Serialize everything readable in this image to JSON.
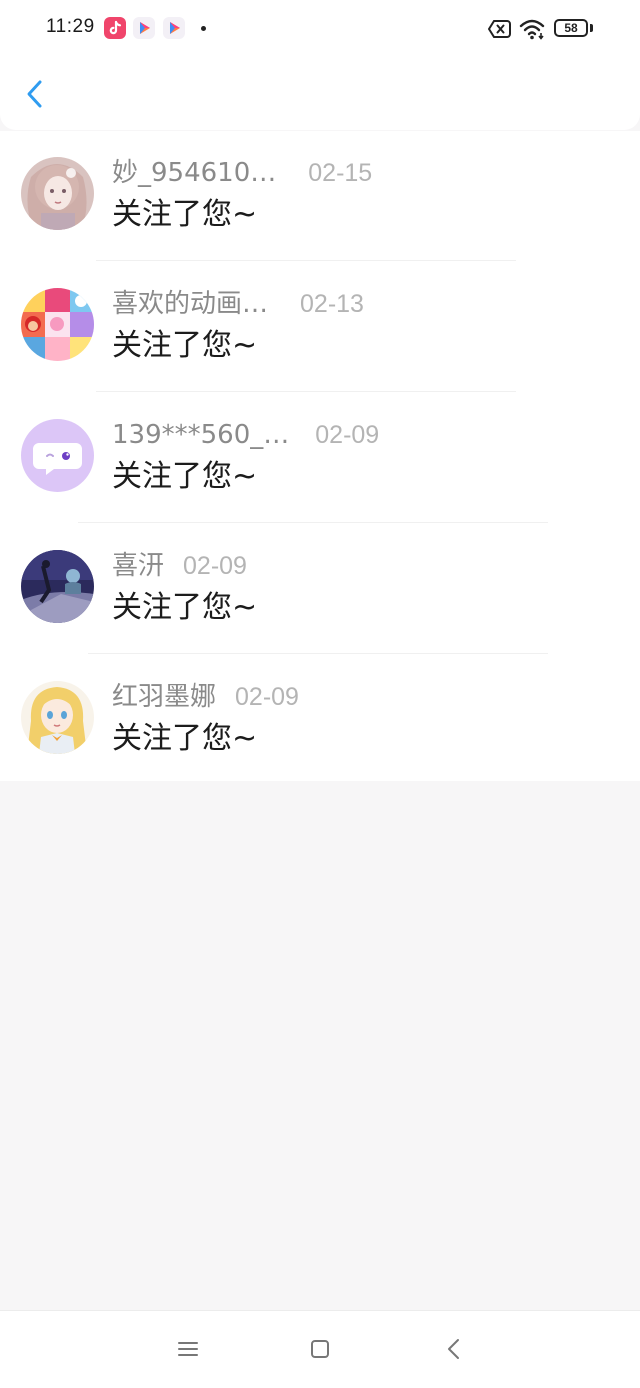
{
  "status_bar": {
    "time": "11:29",
    "battery": "58",
    "icons": [
      "tiktok-icon",
      "play-store-icon",
      "play-store-icon",
      "notification-dot",
      "no-sim-icon",
      "wifi-icon",
      "battery-icon"
    ]
  },
  "header": {
    "back_icon": "chevron-left-icon",
    "accent_color": "#2f9cf0"
  },
  "notifications": [
    {
      "username": "妙_954610…",
      "date": "02-15",
      "message": "关注了您~",
      "avatar": "anime-girl-avatar"
    },
    {
      "username": "喜欢的动画…",
      "date": "02-13",
      "message": "关注了您~",
      "avatar": "cartoon-collage-avatar"
    },
    {
      "username": "139***560_…",
      "date": "02-09",
      "message": "关注了您~",
      "avatar": "default-chat-avatar"
    },
    {
      "username": "喜汧",
      "date": "02-09",
      "message": "关注了您~",
      "avatar": "night-scene-avatar"
    },
    {
      "username": "红羽墨娜",
      "date": "02-09",
      "message": "关注了您~",
      "avatar": "blonde-character-avatar"
    }
  ],
  "nav_bar": {
    "icons": [
      "menu-icon",
      "home-square-icon",
      "back-triangle-icon"
    ]
  }
}
